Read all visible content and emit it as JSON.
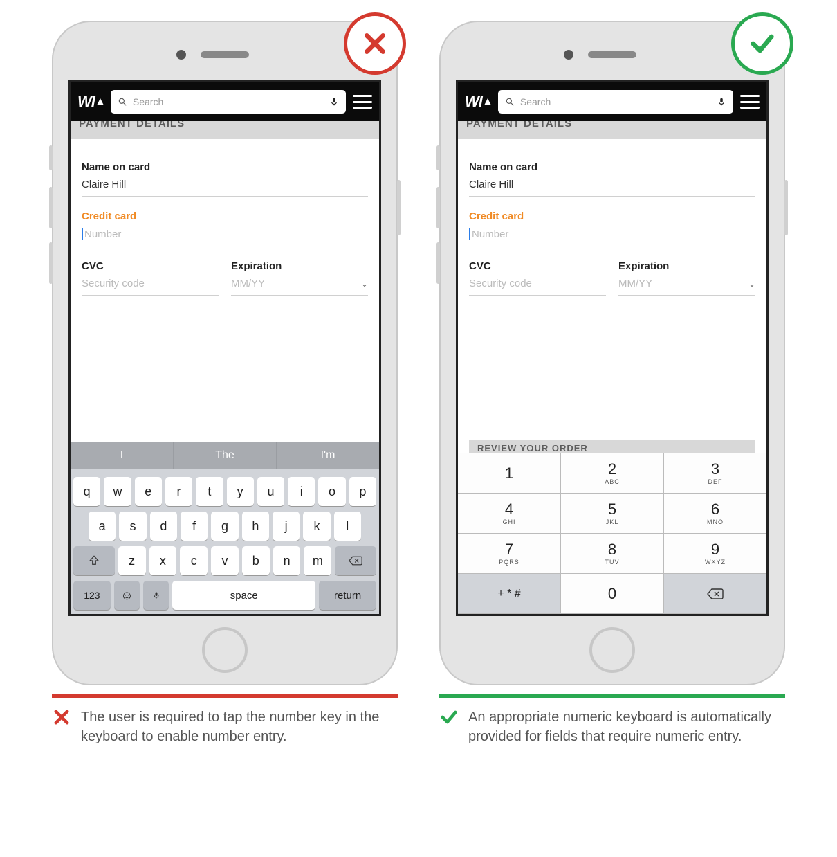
{
  "colors": {
    "bad": "#d43a2f",
    "good": "#2aa951",
    "accent": "#f08a24"
  },
  "app": {
    "search_placeholder": "Search",
    "section_title": "PAYMENT DETAILS",
    "review_cut": "REVIEW YOUR ORDER",
    "fields": {
      "name_label": "Name on card",
      "name_value": "Claire Hill",
      "cc_label": "Credit card",
      "cc_placeholder": "Number",
      "cvc_label": "CVC",
      "cvc_placeholder": "Security code",
      "exp_label": "Expiration",
      "exp_placeholder": "MM/YY"
    }
  },
  "qwerty": {
    "suggestions": [
      "I",
      "The",
      "I'm"
    ],
    "row1": [
      "q",
      "w",
      "e",
      "r",
      "t",
      "y",
      "u",
      "i",
      "o",
      "p"
    ],
    "row2": [
      "a",
      "s",
      "d",
      "f",
      "g",
      "h",
      "j",
      "k",
      "l"
    ],
    "row3": [
      "z",
      "x",
      "c",
      "v",
      "b",
      "n",
      "m"
    ],
    "numkey": "123",
    "space": "space",
    "return": "return"
  },
  "numpad": {
    "keys": [
      [
        {
          "d": "1",
          "s": ""
        },
        {
          "d": "2",
          "s": "ABC"
        },
        {
          "d": "3",
          "s": "DEF"
        }
      ],
      [
        {
          "d": "4",
          "s": "GHI"
        },
        {
          "d": "5",
          "s": "JKL"
        },
        {
          "d": "6",
          "s": "MNO"
        }
      ],
      [
        {
          "d": "7",
          "s": "PQRS"
        },
        {
          "d": "8",
          "s": "TUV"
        },
        {
          "d": "9",
          "s": "WXYZ"
        }
      ]
    ],
    "sym": "+ * #",
    "zero": "0"
  },
  "captions": {
    "bad": "The user is required to tap the number key in the keyboard to enable number entry.",
    "good": "An appropriate numeric keyboard is automatically provided for fields that require numeric entry."
  }
}
